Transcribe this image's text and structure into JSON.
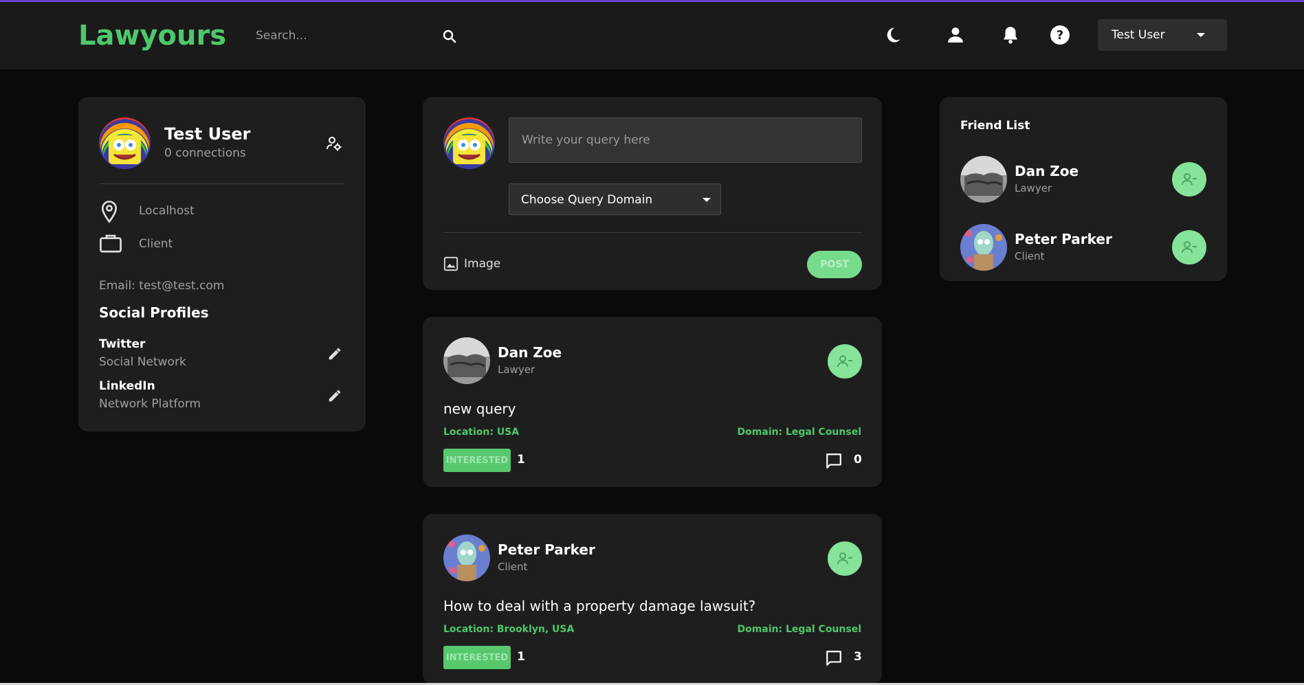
{
  "brand": {
    "name": "Lawyours",
    "accent_color": "#4ec86a",
    "top_line_color": "#6a3fc8"
  },
  "header": {
    "search_placeholder": "Search...",
    "icons": [
      "search-icon",
      "dark-mode-moon-icon",
      "person-icon",
      "bell-icon",
      "help-icon"
    ],
    "user_menu_label": "Test User"
  },
  "profile": {
    "name": "Test User",
    "connections": "0 connections",
    "location": "Localhost",
    "occupation": "Client",
    "email": "Email: test@test.com",
    "social_title": "Social Profiles",
    "socials": [
      {
        "name": "Twitter",
        "desc": "Social Network"
      },
      {
        "name": "LinkedIn",
        "desc": "Network Platform"
      }
    ]
  },
  "compose": {
    "query_placeholder": "Write your query here",
    "domain_select_label": "Choose Query Domain",
    "image_label": "Image",
    "post_label": "POST"
  },
  "posts": [
    {
      "author": "Dan Zoe",
      "role": "Lawyer",
      "text": "new query",
      "location": "Location: USA",
      "domain": "Domain: Legal Counsel",
      "interested_label": "INTERESTED",
      "interested_count": "1",
      "comment_count": "0"
    },
    {
      "author": "Peter Parker",
      "role": "Client",
      "text": "How to deal with a property damage lawsuit?",
      "location": "Location: Brooklyn, USA",
      "domain": "Domain: Legal Counsel",
      "interested_label": "INTERESTED",
      "interested_count": "1",
      "comment_count": "3"
    }
  ],
  "friends": {
    "title": "Friend List",
    "items": [
      {
        "name": "Dan Zoe",
        "role": "Lawyer"
      },
      {
        "name": "Peter Parker",
        "role": "Client"
      }
    ]
  }
}
